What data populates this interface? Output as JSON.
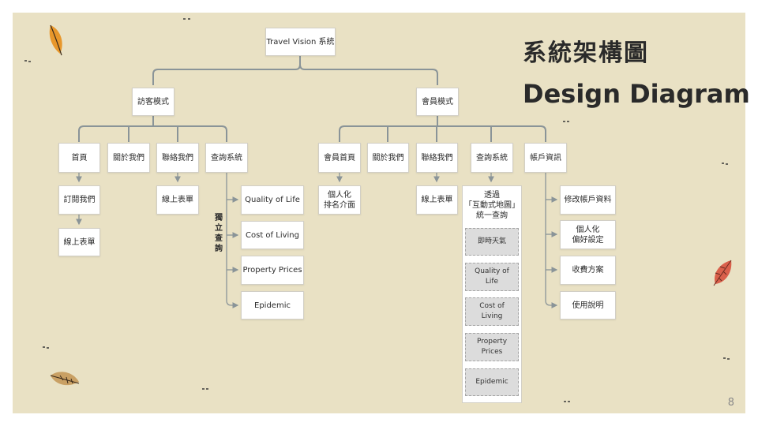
{
  "slide": {
    "title_zh": "系統架構圖",
    "title_en": "Design Diagram",
    "page_number": "8"
  },
  "root": "Travel Vision 系統",
  "guest": {
    "label": "訪客模式",
    "home": "首頁",
    "subscribe": "訂閱我們",
    "online_form_home": "線上表單",
    "about": "關於我們",
    "contact": "聯絡我們",
    "online_form_contact": "線上表單",
    "query": "查詢系統",
    "independent_query": "獨立查詢",
    "query_items": [
      "Quality of Life",
      "Cost of Living",
      "Property Prices",
      "Epidemic"
    ]
  },
  "member": {
    "label": "會員模式",
    "home": "會員首頁",
    "home_child": "個人化\n排名介面",
    "about": "關於我們",
    "contact": "聯絡我們",
    "online_form": "線上表單",
    "query": "查詢系統",
    "map_query": "透過\n「互動式地圖」\n統一查詢",
    "map_items": [
      "即時天氣",
      "Quality of\nLife",
      "Cost of\nLiving",
      "Property\nPrices",
      "Epidemic"
    ],
    "account": "帳戶資訊",
    "account_items": [
      "修改帳戶資料",
      "個人化\n偏好設定",
      "收費方案",
      "使用說明"
    ]
  },
  "colors": {
    "background": "#e9e1c4",
    "connector": "#8a9498",
    "node_fill": "#ffffff",
    "gray_node": "#dcdcdc"
  },
  "decorations": [
    "orange-leaf-icon",
    "red-leaf-icon",
    "brown-leaf-icon"
  ]
}
